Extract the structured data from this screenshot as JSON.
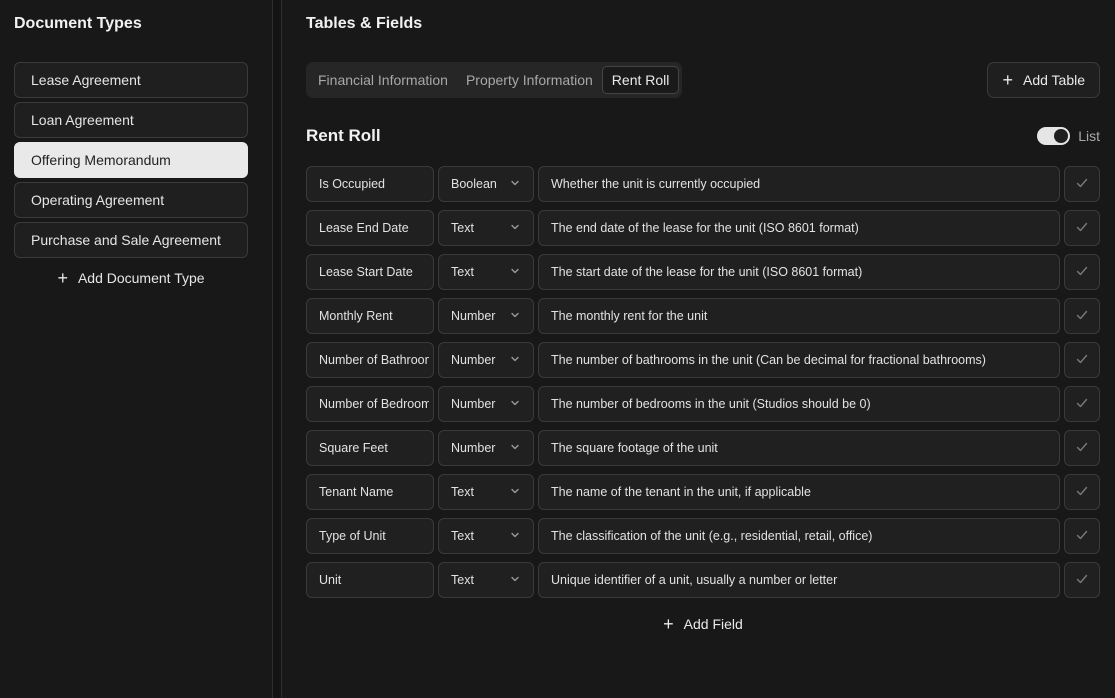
{
  "sidebar": {
    "title": "Document Types",
    "items": [
      {
        "label": "Lease Agreement",
        "active": false
      },
      {
        "label": "Loan Agreement",
        "active": false
      },
      {
        "label": "Offering Memorandum",
        "active": true
      },
      {
        "label": "Operating Agreement",
        "active": false
      },
      {
        "label": "Purchase and Sale Agreement",
        "active": false
      }
    ],
    "add_label": "Add Document Type"
  },
  "main": {
    "title": "Tables & Fields",
    "tabs": [
      {
        "label": "Financial Information",
        "active": false
      },
      {
        "label": "Property Information",
        "active": false
      },
      {
        "label": "Rent Roll",
        "active": true
      }
    ],
    "add_table_label": "Add Table",
    "section_title": "Rent Roll",
    "list_label": "List",
    "list_enabled": true,
    "fields": [
      {
        "name": "Is Occupied",
        "type": "Boolean",
        "description": "Whether the unit is currently occupied"
      },
      {
        "name": "Lease End Date",
        "type": "Text",
        "description": "The end date of the lease for the unit (ISO 8601 format)"
      },
      {
        "name": "Lease Start Date",
        "type": "Text",
        "description": "The start date of the lease for the unit (ISO 8601 format)"
      },
      {
        "name": "Monthly Rent",
        "type": "Number",
        "description": "The monthly rent for the unit"
      },
      {
        "name": "Number of Bathrooms",
        "type": "Number",
        "description": "The number of bathrooms in the unit (Can be decimal for fractional bathrooms)"
      },
      {
        "name": "Number of Bedrooms",
        "type": "Number",
        "description": "The number of bedrooms in the unit (Studios should be 0)"
      },
      {
        "name": "Square Feet",
        "type": "Number",
        "description": "The square footage of the unit"
      },
      {
        "name": "Tenant Name",
        "type": "Text",
        "description": "The name of the tenant in the unit, if applicable"
      },
      {
        "name": "Type of Unit",
        "type": "Text",
        "description": "The classification of the unit (e.g., residential, retail, office)"
      },
      {
        "name": "Unit",
        "type": "Text",
        "description": "Unique identifier of a unit, usually a number or letter"
      }
    ],
    "add_field_label": "Add Field"
  },
  "icons": {
    "plus": "plus-icon",
    "chevron": "chevron-down-icon",
    "check": "check-icon"
  }
}
